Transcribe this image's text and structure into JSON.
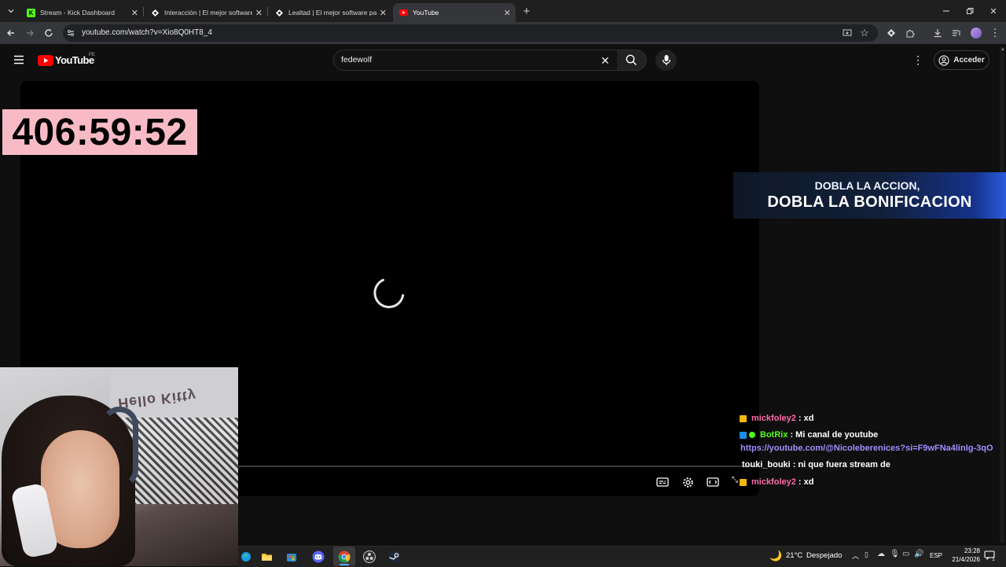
{
  "browser": {
    "tabs": [
      {
        "title": "Stream - Kick Dashboard",
        "icon": "kick-icon",
        "color": "#53fc18"
      },
      {
        "title": "Interacción | El mejor software para",
        "icon": "botrix-icon",
        "color": "#ffffff"
      },
      {
        "title": "Lealtad | El mejor software para",
        "icon": "botrix-icon",
        "color": "#ffffff"
      },
      {
        "title": "YouTube",
        "icon": "youtube-icon",
        "color": "#ff0000"
      }
    ],
    "url": "youtube.com/watch?v=Xio8Q0HT8_4"
  },
  "youtube": {
    "logo_text": "YouTube",
    "region": "PE",
    "search_value": "fedewolf",
    "signin_label": "Acceder"
  },
  "overlay": {
    "timer": "406:59:52",
    "promo_line1": "DOBLA LA ACCION,",
    "promo_line2": "DOBLA LA BONIFICACION",
    "hello_kitty_text": "Hello Kitty"
  },
  "chat": [
    {
      "user": "mickfoley2",
      "message": ": xd",
      "user_color": "#ff6aa8",
      "badge": "crown-badge"
    },
    {
      "user": "BotRix",
      "message": ": Mi canal de youtube",
      "user_color": "#53fc18",
      "badge": "bot-badge"
    },
    {
      "user": "",
      "message": "https://youtube.com/@Nicoleberenices?si=F9wFNa4linIg-3qO",
      "user_color": "#a58bff",
      "badge": ""
    },
    {
      "user": "touki_bouki",
      "message": ": ni que fuera stream de",
      "user_color": "#ffffff",
      "badge": ""
    },
    {
      "user": "mickfoley2",
      "message": ": xd",
      "user_color": "#ff6aa8",
      "badge": "crown-badge"
    }
  ],
  "taskbar": {
    "weather_temp": "21°C",
    "weather_desc": "Despejado",
    "language": "ESP",
    "time": "23:28",
    "date": "21/4/2026",
    "notifications": "1"
  }
}
